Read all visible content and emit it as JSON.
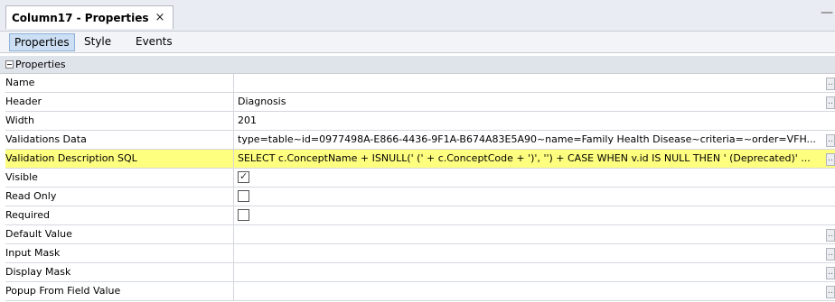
{
  "tab": {
    "title": "Column17 - Properties",
    "close_glyph": "×"
  },
  "minimize_glyph": "—",
  "subtabs": [
    {
      "label": "Properties",
      "active": true
    },
    {
      "label": "Style",
      "active": false
    },
    {
      "label": "Events",
      "active": false
    }
  ],
  "section": {
    "label": "Properties",
    "state": "expanded"
  },
  "ellipsis_glyph": "..",
  "rows": {
    "name": {
      "label": "Name",
      "value": ""
    },
    "header": {
      "label": "Header",
      "value": "Diagnosis"
    },
    "width": {
      "label": "Width",
      "value": "201"
    },
    "validations_data": {
      "label": "Validations Data",
      "value": "type=table~id=0977498A-E866-4436-9F1A-B674A83E5A90~name=Family Health Disease~criteria=~order=VFH..."
    },
    "validation_description_sql": {
      "label": "Validation Description SQL",
      "value": "SELECT c.ConceptName + ISNULL(' (' + c.ConceptCode + ')', '') + CASE WHEN v.id IS NULL THEN ' (Deprecated)' ..."
    },
    "visible": {
      "label": "Visible",
      "checked": true
    },
    "read_only": {
      "label": "Read Only",
      "checked": false
    },
    "required": {
      "label": "Required",
      "checked": false
    },
    "default_value": {
      "label": "Default Value",
      "value": ""
    },
    "input_mask": {
      "label": "Input Mask",
      "value": ""
    },
    "display_mask": {
      "label": "Display Mask",
      "value": ""
    },
    "popup_from_field_value": {
      "label": "Popup From Field Value",
      "value": ""
    }
  },
  "colors": {
    "highlight_row": "#ffff7f",
    "active_subtab": "#ccdff4"
  }
}
